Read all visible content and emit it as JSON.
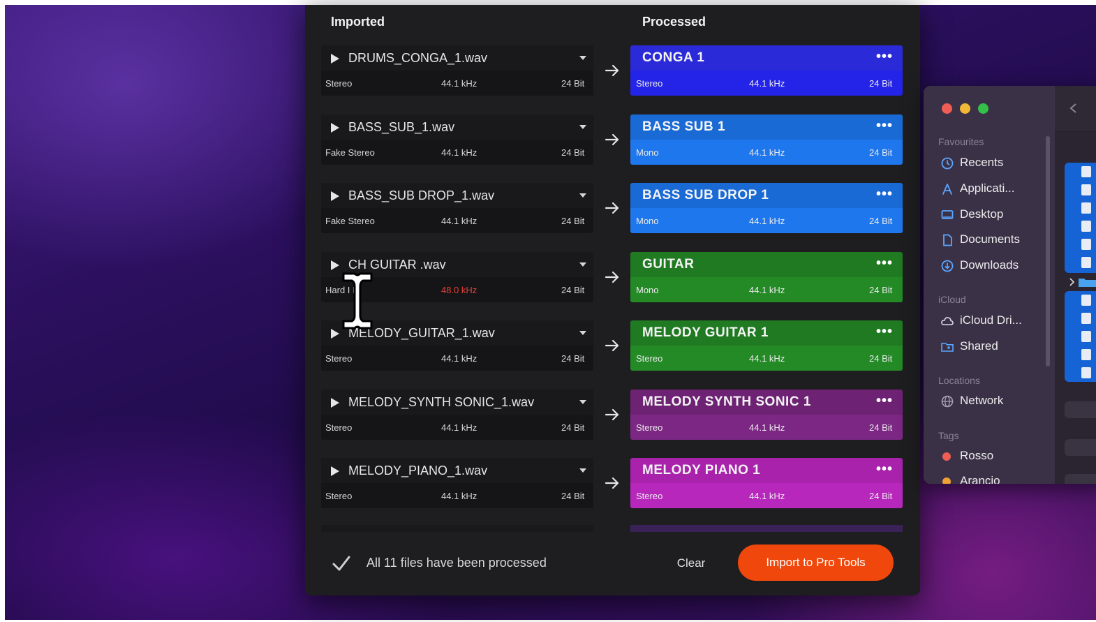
{
  "app": {
    "columns": {
      "imported": "Imported",
      "processed": "Processed"
    },
    "rows": [
      {
        "file": "DRUMS_CONGA_1.wav",
        "src_channels": "Stereo",
        "src_rate": "44.1 kHz",
        "src_bits": "24 Bit",
        "src_rate_warning": false,
        "name": "CONGA 1",
        "dst_channels": "Stereo",
        "dst_rate": "44.1 kHz",
        "dst_bits": "24 Bit",
        "color_top": "#2a2ad8",
        "color_bottom": "#2424e8"
      },
      {
        "file": "BASS_SUB_1.wav",
        "src_channels": "Fake Stereo",
        "src_rate": "44.1 kHz",
        "src_bits": "24 Bit",
        "src_rate_warning": false,
        "name": "BASS SUB 1",
        "dst_channels": "Mono",
        "dst_rate": "44.1 kHz",
        "dst_bits": "24 Bit",
        "color_top": "#1a6ad6",
        "color_bottom": "#1f77ee"
      },
      {
        "file": "BASS_SUB DROP_1.wav",
        "src_channels": "Fake Stereo",
        "src_rate": "44.1 kHz",
        "src_bits": "24 Bit",
        "src_rate_warning": false,
        "name": "BASS SUB DROP 1",
        "dst_channels": "Mono",
        "dst_rate": "44.1 kHz",
        "dst_bits": "24 Bit",
        "color_top": "#1a6ad6",
        "color_bottom": "#1f77ee"
      },
      {
        "file": "CH GUITAR .wav",
        "src_channels": "Hard I   R",
        "src_rate": "48.0 kHz",
        "src_bits": "24 Bit",
        "src_rate_warning": true,
        "name": "GUITAR",
        "dst_channels": "Mono",
        "dst_rate": "44.1 kHz",
        "dst_bits": "24 Bit",
        "color_top": "#1f7a22",
        "color_bottom": "#238a26"
      },
      {
        "file": "MELODY_GUITAR_1.wav",
        "src_channels": "Stereo",
        "src_rate": "44.1 kHz",
        "src_bits": "24 Bit",
        "src_rate_warning": false,
        "name": "MELODY GUITAR 1",
        "dst_channels": "Stereo",
        "dst_rate": "44.1 kHz",
        "dst_bits": "24 Bit",
        "color_top": "#1f7a22",
        "color_bottom": "#238a26"
      },
      {
        "file": "MELODY_SYNTH SONIC_1.wav",
        "src_channels": "Stereo",
        "src_rate": "44.1 kHz",
        "src_bits": "24 Bit",
        "src_rate_warning": false,
        "name": "MELODY SYNTH SONIC 1",
        "dst_channels": "Stereo",
        "dst_rate": "44.1 kHz",
        "dst_bits": "24 Bit",
        "color_top": "#6e2274",
        "color_bottom": "#7c2784"
      },
      {
        "file": "MELODY_PIANO_1.wav",
        "src_channels": "Stereo",
        "src_rate": "44.1 kHz",
        "src_bits": "24 Bit",
        "src_rate_warning": false,
        "name": "MELODY PIANO 1",
        "dst_channels": "Stereo",
        "dst_rate": "44.1 kHz",
        "dst_bits": "24 Bit",
        "color_top": "#a822ac",
        "color_bottom": "#b827bc"
      }
    ],
    "footer": {
      "status": "All 11 files have been processed",
      "clear_label": "Clear",
      "import_label": "Import to Pro Tools"
    },
    "colors": {
      "accent": "#f0480c",
      "warning": "#e0413a"
    }
  },
  "finder": {
    "sections": {
      "favourites": "Favourites",
      "icloud": "iCloud",
      "locations": "Locations",
      "tags": "Tags"
    },
    "favourites": [
      {
        "label": "Recents",
        "icon": "clock-icon"
      },
      {
        "label": "Applicati...",
        "icon": "apps-icon"
      },
      {
        "label": "Desktop",
        "icon": "desktop-icon"
      },
      {
        "label": "Documents",
        "icon": "document-icon"
      },
      {
        "label": "Downloads",
        "icon": "download-icon"
      }
    ],
    "icloud": [
      {
        "label": "iCloud Dri...",
        "icon": "cloud-icon"
      },
      {
        "label": "Shared",
        "icon": "shared-folder-icon"
      }
    ],
    "locations": [
      {
        "label": "Network",
        "icon": "globe-icon"
      }
    ],
    "tags": [
      {
        "label": "Rosso",
        "color": "#ee5e55"
      },
      {
        "label": "Arancio",
        "color": "#f1a037"
      }
    ]
  }
}
